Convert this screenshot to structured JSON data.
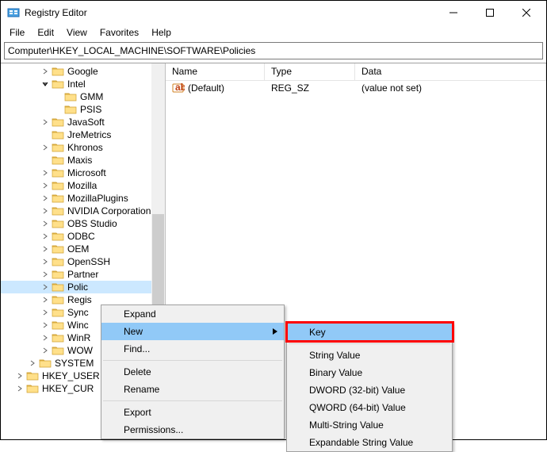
{
  "window": {
    "title": "Registry Editor"
  },
  "menubar": {
    "file": "File",
    "edit": "Edit",
    "view": "View",
    "favorites": "Favorites",
    "help": "Help"
  },
  "address": "Computer\\HKEY_LOCAL_MACHINE\\SOFTWARE\\Policies",
  "tree": {
    "items": [
      {
        "depth": 3,
        "exp": "closed",
        "label": "Google"
      },
      {
        "depth": 3,
        "exp": "open",
        "label": "Intel"
      },
      {
        "depth": 4,
        "exp": "none",
        "label": "GMM"
      },
      {
        "depth": 4,
        "exp": "none",
        "label": "PSIS"
      },
      {
        "depth": 3,
        "exp": "closed",
        "label": "JavaSoft"
      },
      {
        "depth": 3,
        "exp": "none",
        "label": "JreMetrics"
      },
      {
        "depth": 3,
        "exp": "closed",
        "label": "Khronos"
      },
      {
        "depth": 3,
        "exp": "none",
        "label": "Maxis"
      },
      {
        "depth": 3,
        "exp": "closed",
        "label": "Microsoft"
      },
      {
        "depth": 3,
        "exp": "closed",
        "label": "Mozilla"
      },
      {
        "depth": 3,
        "exp": "closed",
        "label": "MozillaPlugins"
      },
      {
        "depth": 3,
        "exp": "closed",
        "label": "NVIDIA Corporation"
      },
      {
        "depth": 3,
        "exp": "closed",
        "label": "OBS Studio"
      },
      {
        "depth": 3,
        "exp": "closed",
        "label": "ODBC"
      },
      {
        "depth": 3,
        "exp": "closed",
        "label": "OEM"
      },
      {
        "depth": 3,
        "exp": "closed",
        "label": "OpenSSH"
      },
      {
        "depth": 3,
        "exp": "closed",
        "label": "Partner"
      },
      {
        "depth": 3,
        "exp": "closed",
        "label": "Polic",
        "selected": true
      },
      {
        "depth": 3,
        "exp": "closed",
        "label": "Regis"
      },
      {
        "depth": 3,
        "exp": "closed",
        "label": "Sync"
      },
      {
        "depth": 3,
        "exp": "closed",
        "label": "Winc"
      },
      {
        "depth": 3,
        "exp": "closed",
        "label": "WinR"
      },
      {
        "depth": 3,
        "exp": "closed",
        "label": "WOW"
      },
      {
        "depth": 2,
        "exp": "closed",
        "label": "SYSTEM"
      },
      {
        "depth": 1,
        "exp": "closed",
        "label": "HKEY_USER"
      },
      {
        "depth": 1,
        "exp": "closed",
        "label": "HKEY_CUR"
      }
    ]
  },
  "list": {
    "headers": {
      "name": "Name",
      "type": "Type",
      "data": "Data"
    },
    "rows": [
      {
        "name": "(Default)",
        "type": "REG_SZ",
        "data": "(value not set)"
      }
    ]
  },
  "context_menu": {
    "expand": "Expand",
    "new": "New",
    "find": "Find...",
    "delete": "Delete",
    "rename": "Rename",
    "export": "Export",
    "permissions": "Permissions..."
  },
  "submenu": {
    "key": "Key",
    "string": "String Value",
    "binary": "Binary Value",
    "dword": "DWORD (32-bit) Value",
    "qword": "QWORD (64-bit) Value",
    "multistring": "Multi-String Value",
    "expstring": "Expandable String Value"
  }
}
